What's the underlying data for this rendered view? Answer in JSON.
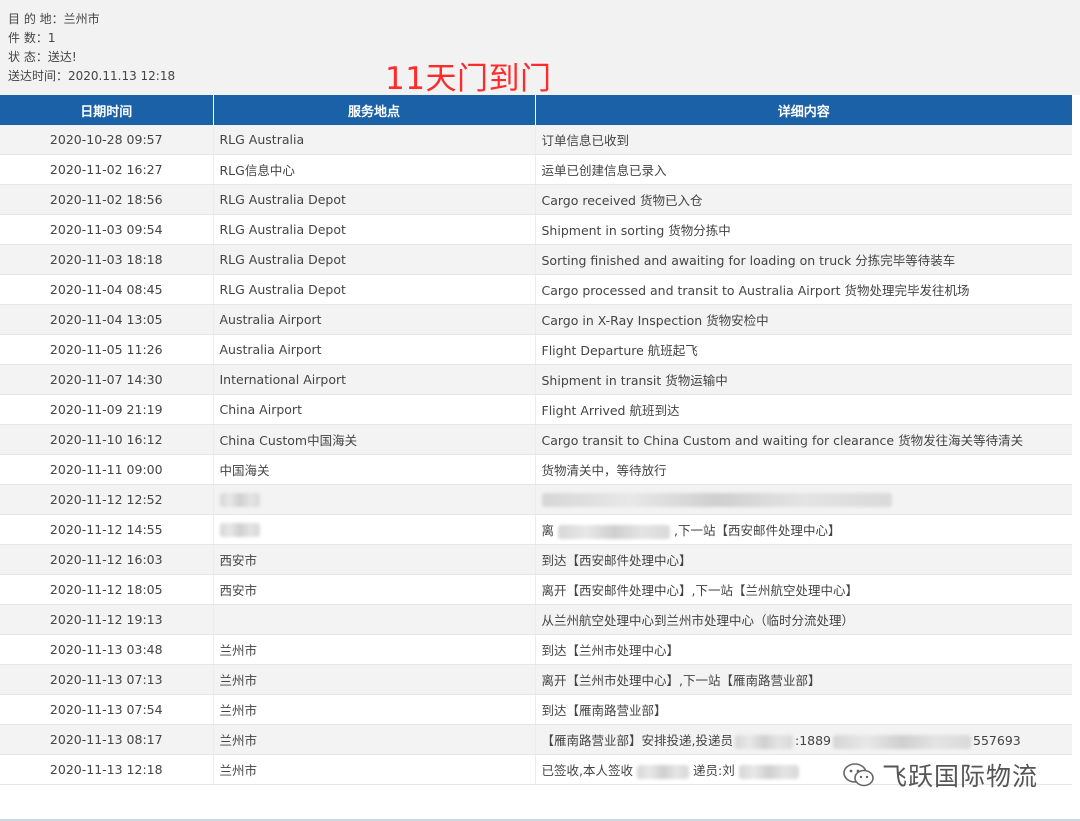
{
  "summary": {
    "destination": "目 的 地：兰州市",
    "pieces": "件 数：1",
    "status": "状 态：送达!",
    "delivered_time": "送达时间：2020.11.13 12:18"
  },
  "headline": "11天门到门",
  "table": {
    "headers": [
      "日期时间",
      "服务地点",
      "详细内容"
    ],
    "rows": [
      {
        "time": "2020-10-28 09:57",
        "location": "RLG Australia",
        "detail": "订单信息已收到"
      },
      {
        "time": "2020-11-02 16:27",
        "location": "RLG信息中心",
        "detail": "运单已创建信息已录入"
      },
      {
        "time": "2020-11-02 18:56",
        "location": "RLG Australia Depot",
        "detail": "Cargo received 货物已入仓"
      },
      {
        "time": "2020-11-03 09:54",
        "location": "RLG Australia Depot",
        "detail": "Shipment in sorting 货物分拣中"
      },
      {
        "time": "2020-11-03 18:18",
        "location": "RLG Australia Depot",
        "detail": "Sorting finished and awaiting for loading on truck 分拣完毕等待装车"
      },
      {
        "time": "2020-11-04 08:45",
        "location": "RLG Australia Depot",
        "detail": "Cargo processed and transit to Australia Airport 货物处理完毕发往机场"
      },
      {
        "time": "2020-11-04 13:05",
        "location": "Australia Airport",
        "detail": "Cargo in X-Ray Inspection 货物安检中"
      },
      {
        "time": "2020-11-05 11:26",
        "location": "Australia Airport",
        "detail": "Flight Departure 航班起飞"
      },
      {
        "time": "2020-11-07 14:30",
        "location": "International Airport",
        "detail": "Shipment in transit 货物运输中"
      },
      {
        "time": "2020-11-09 21:19",
        "location": "China Airport",
        "detail": "Flight Arrived 航班到达"
      },
      {
        "time": "2020-11-10 16:12",
        "location": "China Custom中国海关",
        "detail": "Cargo transit to China Custom and waiting for clearance 货物发往海关等待清关"
      },
      {
        "time": "2020-11-11 09:00",
        "location": "中国海关",
        "detail": "货物清关中，等待放行"
      },
      {
        "time": "2020-11-12 12:52",
        "location": "",
        "detail": ""
      },
      {
        "time": "2020-11-12 14:55",
        "location": "",
        "detail": ""
      },
      {
        "time": "2020-11-12 16:03",
        "location": "西安市",
        "detail": "到达【西安邮件处理中心】"
      },
      {
        "time": "2020-11-12 18:05",
        "location": "西安市",
        "detail": "离开【西安邮件处理中心】,下一站【兰州航空处理中心】"
      },
      {
        "time": "2020-11-12 19:13",
        "location": "",
        "detail": "从兰州航空处理中心到兰州市处理中心（临时分流处理）"
      },
      {
        "time": "2020-11-13 03:48",
        "location": "兰州市",
        "detail": "到达【兰州市处理中心】"
      },
      {
        "time": "2020-11-13 07:13",
        "location": "兰州市",
        "detail": "离开【兰州市处理中心】,下一站【雁南路营业部】"
      },
      {
        "time": "2020-11-13 07:54",
        "location": "兰州市",
        "detail": "到达【雁南路营业部】"
      },
      {
        "time": "2020-11-13 08:17",
        "location": "兰州市",
        "detail": ""
      },
      {
        "time": "2020-11-13 12:18",
        "location": "兰州市",
        "detail": ""
      }
    ],
    "partial": {
      "r13_prefix": "离",
      "r13_suffix": ",下一站【西安邮件处理中心】",
      "r20_prefix": "【雁南路营业部】安排投递,投递员",
      "r20_mid": ":1889",
      "r20_suffix": "557693",
      "r21_prefix": "已签收,本人签收",
      "r21_mid": "递员:刘"
    }
  },
  "watermark": {
    "text": "飞跃国际物流",
    "icon": "wechat-icon"
  }
}
